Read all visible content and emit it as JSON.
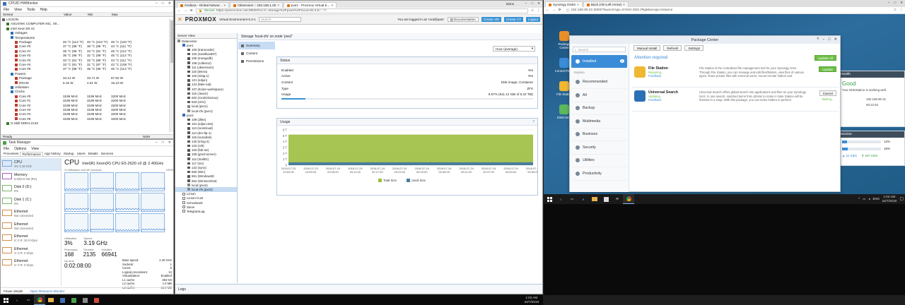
{
  "hwmon": {
    "title": "CPUID HWMonitor",
    "menu": [
      "File",
      "View",
      "Tools",
      "Help"
    ],
    "cols": [
      "Sensor",
      "Value",
      "Min",
      "Max"
    ],
    "rows": [
      {
        "n": "LICSON",
        "v": "",
        "mi": "",
        "ma": "",
        "d": 0
      },
      {
        "n": "ASUSTeK COMPUTER INC. X9...",
        "v": "",
        "mi": "",
        "ma": "",
        "d": 1
      },
      {
        "n": "Intel Xeon E5 v3",
        "v": "",
        "mi": "",
        "ma": "",
        "d": 1
      },
      {
        "n": "Voltages",
        "v": "",
        "mi": "",
        "ma": "",
        "d": 2
      },
      {
        "n": "Temperatures",
        "v": "",
        "mi": "",
        "ma": "",
        "d": 2
      },
      {
        "n": "Package",
        "v": "45 °C (113 °F)",
        "mi": "40 °C (104 °F)",
        "ma": "49 °C (120 °F)",
        "d": 3
      },
      {
        "n": "Core #0",
        "v": "37 °C (98 °F)",
        "mi": "36 °C (96 °F)",
        "ma": "44 °C (111 °F)",
        "d": 3
      },
      {
        "n": "Core #1",
        "v": "36 °C (96 °F)",
        "mi": "33 °C (91 °F)",
        "ma": "45 °C (113 °F)",
        "d": 3
      },
      {
        "n": "Core #2",
        "v": "36 °C (96 °F)",
        "mi": "32 °C (89 °F)",
        "ma": "45 °C (113 °F)",
        "d": 3
      },
      {
        "n": "Core #3",
        "v": "33 °C (91 °F)",
        "mi": "32 °C (89 °F)",
        "ma": "44 °C (111 °F)",
        "d": 3
      },
      {
        "n": "Core #4",
        "v": "33 °C (91 °F)",
        "mi": "31 °C (87 °F)",
        "ma": "43 °C (109 °F)",
        "d": 3
      },
      {
        "n": "Core #5",
        "v": "37 °C (98 °F)",
        "mi": "36 °C (96 °F)",
        "ma": "45 °C (113 °F)",
        "d": 3
      },
      {
        "n": "Powers",
        "v": "",
        "mi": "",
        "ma": "",
        "d": 2
      },
      {
        "n": "Package",
        "v": "34.12 W",
        "mi": "33.71 W",
        "ma": "67.82 W",
        "d": 3
      },
      {
        "n": "DRAM",
        "v": "6.15 W",
        "mi": "4.51 W",
        "ma": "15.10 W",
        "d": 3
      },
      {
        "n": "Utilization",
        "v": "",
        "mi": "",
        "ma": "",
        "d": 2
      },
      {
        "n": "Clocks",
        "v": "",
        "mi": "",
        "ma": "",
        "d": 2
      },
      {
        "n": "Core #0",
        "v": "3199 MHz",
        "mi": "3199 MHz",
        "ma": "3200 MHz",
        "d": 3
      },
      {
        "n": "Core #1",
        "v": "3199 MHz",
        "mi": "3199 MHz",
        "ma": "3200 MHz",
        "d": 3
      },
      {
        "n": "Core #2",
        "v": "3199 MHz",
        "mi": "3199 MHz",
        "ma": "3200 MHz",
        "d": 3
      },
      {
        "n": "Core #3",
        "v": "3199 MHz",
        "mi": "3199 MHz",
        "ma": "3200 MHz",
        "d": 3
      },
      {
        "n": "Core #4",
        "v": "3199 MHz",
        "mi": "3199 MHz",
        "ma": "3200 MHz",
        "d": 3
      },
      {
        "n": "Core #5",
        "v": "3199 MHz",
        "mi": "3199 MHz",
        "ma": "3200 MHz",
        "d": 3
      },
      {
        "n": "G.Skill DDR4-2133",
        "v": "",
        "mi": "",
        "ma": "",
        "d": 1
      }
    ],
    "status_left": "Ready",
    "status_right": "NUM"
  },
  "taskmgr": {
    "title": "Task Manager",
    "menu": [
      "File",
      "Options",
      "View"
    ],
    "tabs": [
      "Processes",
      "Performance",
      "App history",
      "Startup",
      "Users",
      "Details",
      "Services"
    ],
    "active_tab": 1,
    "side": [
      {
        "t1": "CPU",
        "t2": "3%  3.19 GHz",
        "c": "blue"
      },
      {
        "t1": "Memory",
        "t2": "5.6/63.9 GB (9%)",
        "c": "purple"
      },
      {
        "t1": "Disk 0 (D:)",
        "t2": "0%",
        "c": "green"
      },
      {
        "t1": "Disk 1 (C:)",
        "t2": "0%",
        "c": "green"
      },
      {
        "t1": "Ethernet",
        "t2": "Not connected",
        "c": "orange"
      },
      {
        "t1": "Ethernet",
        "t2": "Not connected",
        "c": "orange"
      },
      {
        "t1": "Ethernet",
        "t2": "S: 0  R: 30.0 Kbps",
        "c": "orange"
      },
      {
        "t1": "Ethernet",
        "t2": "S: 0  R: 0 Kbps",
        "c": "orange"
      },
      {
        "t1": "Ethernet",
        "t2": "S: 0  R: 0 Kbps",
        "c": "orange"
      }
    ],
    "cpu_title": "CPU",
    "cpu_model": "Intel(R) Xeon(R) CPU E5-2620 v3 @ 2.40GHz",
    "util_label": "% Utilization over 60 seconds",
    "max_label": "100%",
    "stats": {
      "util_k": "Utilization",
      "util_v": "3%",
      "speed_k": "Speed",
      "speed_v": "3.19 GHz",
      "proc_k": "Processes",
      "proc_v": "168",
      "thr_k": "Threads",
      "thr_v": "2135",
      "hdl_k": "Handles",
      "hdl_v": "66941",
      "up_k": "Up time",
      "up_v": "0:02:08:00"
    },
    "specs": [
      [
        "Base speed:",
        "2.40 GHz"
      ],
      [
        "Sockets:",
        "1"
      ],
      [
        "Cores:",
        "6"
      ],
      [
        "Logical processors:",
        "12"
      ],
      [
        "Virtualization:",
        "Enabled"
      ],
      [
        "L1 cache:",
        "384 KB"
      ],
      [
        "L2 cache:",
        "1.5 MB"
      ],
      [
        "L3 cache:",
        "15.0 MB"
      ]
    ],
    "fewer": "Fewer details",
    "resmon": "Open Resource Monitor"
  },
  "chrome1": {
    "tabs": [
      {
        "label": "pve1 - Proxmox Virtual E...",
        "on": true
      },
      {
        "label": "Observium :: 192.168.1.20",
        "on": false
      },
      {
        "label": "Grafana - Global Networ...",
        "on": false
      }
    ],
    "user": "Idunx",
    "secure": "Secure",
    "url": "https://pvel.licson.net:8006/#v1:0:=storage%2Fpve2%2Flocal-zfs:4:5:::::7:",
    "pve": {
      "logo": "PROXMOX",
      "version": "Virtual Environment 5.2-1",
      "search_placeholder": "Search",
      "logged": "You are logged in as 'root@pam'",
      "doc": "Documentation",
      "create_vm": "Create VM",
      "create_ct": "Create CT",
      "logout": "Logout",
      "server_view": "Server View",
      "tree": [
        {
          "t": "Datacenter",
          "d": 0,
          "k": "dc"
        },
        {
          "t": "pve1",
          "d": 1,
          "k": "node"
        },
        {
          "t": "100 (transcoder)",
          "d": 2,
          "k": "vm"
        },
        {
          "t": "102 (sandbox837)",
          "d": 2,
          "k": "vm"
        },
        {
          "t": "105 (mongodb)",
          "d": 2,
          "k": "vm"
        },
        {
          "t": "108 (collector)",
          "d": 2,
          "k": "vm"
        },
        {
          "t": "111 (observium)",
          "d": 2,
          "k": "vm"
        },
        {
          "t": "116 (telera)",
          "d": 2,
          "k": "vm"
        },
        {
          "t": "119 (mlag-1)",
          "d": 2,
          "k": "vm"
        },
        {
          "t": "121 (edjun)",
          "d": 2,
          "k": "vm"
        },
        {
          "t": "124 (fabe-nat)",
          "d": 2,
          "k": "vm"
        },
        {
          "t": "107 (Itcare-workspace)",
          "d": 2,
          "k": "vm"
        },
        {
          "t": "115 (Jason)",
          "d": 2,
          "k": "vm"
        },
        {
          "t": "502 (CentOSLinux)",
          "d": 2,
          "k": "vm"
        },
        {
          "t": "533 (ctrl1)",
          "d": 2,
          "k": "vm"
        },
        {
          "t": "local (pve1)",
          "d": 2,
          "k": "st"
        },
        {
          "t": "local-zfs (pve1)",
          "d": 2,
          "k": "st"
        },
        {
          "t": "pve2",
          "d": 1,
          "k": "node"
        },
        {
          "t": "109 (Jlike)",
          "d": 2,
          "k": "vm"
        },
        {
          "t": "101 (edjun-site)",
          "d": 2,
          "k": "vm"
        },
        {
          "t": "113 (nextcloud)",
          "d": 2,
          "k": "vm"
        },
        {
          "t": "114 (dnr-ftp-1)",
          "d": 2,
          "k": "vm"
        },
        {
          "t": "118 (scandisk)",
          "d": 2,
          "k": "vm"
        },
        {
          "t": "120 (mlog-2)",
          "d": 2,
          "k": "vm"
        },
        {
          "t": "122 (relt)",
          "d": 2,
          "k": "vm"
        },
        {
          "t": "103 (fab-rar)",
          "d": 2,
          "k": "vm"
        },
        {
          "t": "106 (gns3-server)",
          "d": 2,
          "k": "vm"
        },
        {
          "t": "112 (mail01)",
          "d": 2,
          "k": "vm"
        },
        {
          "t": "117 (ms)",
          "d": 2,
          "k": "vm"
        },
        {
          "t": "122 (syno)",
          "d": 2,
          "k": "vm"
        },
        {
          "t": "550 (Win)",
          "d": 2,
          "k": "vm"
        },
        {
          "t": "551 (Windows8)",
          "d": 2,
          "k": "vm"
        },
        {
          "t": "552 (WinSer2016)",
          "d": 2,
          "k": "vm"
        },
        {
          "t": "local (pve2)",
          "d": 2,
          "k": "st"
        },
        {
          "t": "local-zfs (pve2)",
          "d": 2,
          "k": "st",
          "sel": true
        },
        {
          "t": "Licson",
          "d": 1,
          "k": "pool"
        },
        {
          "t": "Licson-Cust",
          "d": 1,
          "k": "pool"
        },
        {
          "t": "Schoolwork",
          "d": 1,
          "k": "pool"
        },
        {
          "t": "Steve",
          "d": 1,
          "k": "pool"
        },
        {
          "t": "TelegramLag",
          "d": 1,
          "k": "pool"
        }
      ],
      "storage_title": "Storage 'local-zfs' on node 'pve2'",
      "nav": [
        "Summary",
        "Content",
        "Permissions"
      ],
      "timeframe": "Hour (average)",
      "status_hdr": "Status",
      "status": [
        [
          "Enabled",
          "Yes"
        ],
        [
          "Active",
          "Yes"
        ],
        [
          "Content",
          "Disk image, Container"
        ],
        [
          "Type",
          "ZFS"
        ],
        [
          "Usage",
          "9.67% (511.12 GiB of 5.22 TiB)"
        ]
      ],
      "usage_frac": 0.0967,
      "usage_hdr": "Usage",
      "legend_total": "Total Size",
      "legend_used": "Used Size",
      "logs": "Logs"
    }
  },
  "chart_data": {
    "type": "area",
    "x": [
      "2018-07-23 23:53:00",
      "2018-07-23 23:59:00",
      "2018-07-24 00:05:00",
      "2018-07-24 00:11:00",
      "2018-07-24 00:17:00",
      "2018-07-24 00:23:00",
      "2018-07-24 00:29:00",
      "2018-07-24 00:35:00",
      "2018-07-24 00:41:00",
      "2018-07-24 00:47:00",
      "2018-07-24 00:53:00",
      "2018-07-24 00:59:00"
    ],
    "series": [
      {
        "name": "Total Size",
        "values": [
          5.2,
          5.2,
          5.2,
          5.2,
          5.2,
          5.2,
          5.2,
          5.2,
          5.2,
          5.2,
          5.2,
          5.2
        ],
        "color": "#9cbf3f"
      },
      {
        "name": "Used Size",
        "values": [
          0.5,
          0.5,
          0.5,
          0.5,
          0.5,
          0.5,
          0.5,
          0.5,
          0.5,
          0.5,
          0.5,
          0.5
        ],
        "color": "#4a7d9e"
      }
    ],
    "yticks": [
      "0",
      "1 T",
      "2 T",
      "3 T",
      "4 T",
      "5 T",
      "6 T"
    ],
    "ylim": [
      0,
      6
    ],
    "grid": true,
    "legend": "bottom"
  },
  "chrome2": {
    "tabs": [
      {
        "label": "Back (Alt+Left Arrow)",
        "on": false
      },
      {
        "label": "Synology DiskS",
        "on": true
      }
    ],
    "url": "192.168.90.31:5000/?launchApp=SYNO.SDS.PkgManApp.Instance",
    "desktop_icons": [
      "Package Center",
      "Control Panel",
      "File Station",
      "DSM Help"
    ],
    "pkg": {
      "title": "Package Center",
      "search": "Search",
      "nav": [
        {
          "t": "Installed",
          "badge": "2",
          "on": true
        },
        {
          "t": "Explore",
          "section": true
        },
        {
          "t": "Recommended"
        },
        {
          "t": "All"
        },
        {
          "t": "Backup"
        },
        {
          "t": "Multimedia"
        },
        {
          "t": "Business"
        },
        {
          "t": "Security"
        },
        {
          "t": "Utilities"
        },
        {
          "t": "Productivity"
        }
      ],
      "buttons": [
        "Manual Install",
        "Refresh",
        "Settings"
      ],
      "attention": "Attention required",
      "update_all": "Update All",
      "items": [
        {
          "name": "File Station",
          "st1": "Repairing...",
          "st2": "Feedback",
          "desc": "File Station is the centralized file management tool for your Synology NAS. Through File Station, you can manage and edit files/folders, view files of various types, share private files with external users, mount remote folders and",
          "btn": "Update",
          "btn2": ""
        },
        {
          "name": "Universal Search",
          "st1": "Updating...",
          "st2": "Feedback",
          "desc": "Universal Search offers global search into applications and files on your Synology NAS. In one search, matched items from photos to notes in Note Station will be finished in a snap. With this package, you can index folders to perform",
          "btn": "Cancel",
          "btn2": "Waiting..."
        }
      ]
    },
    "health": {
      "title": "Health",
      "status": "Good",
      "msg": "Your DiskStation is working well.",
      "ip": "192.168.90.31",
      "uptime": "00:12:52"
    },
    "monitor": {
      "title": "Monitor",
      "cpu_pct": "12%",
      "cpu_frac": 0.12,
      "ram_pct": "15%",
      "ram_frac": 0.15,
      "up": "21 KB/s",
      "down": "837 KB/s"
    }
  },
  "taskbar_left": {
    "time": "1:02 AM",
    "date": "24/7/2018"
  },
  "taskbar_right": {
    "time": "1:02 AM",
    "date": "24/7/2018",
    "lang": "ENG"
  }
}
